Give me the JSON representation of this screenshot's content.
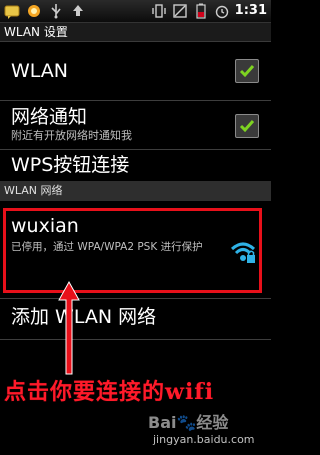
{
  "status_bar": {
    "time": "1:31",
    "left_icons": [
      "sms-icon",
      "weather-icon",
      "usb-icon",
      "upload-icon"
    ],
    "right_icons": [
      "vibrate-icon",
      "no-signal-icon",
      "battery-icon",
      "alarm-icon"
    ]
  },
  "title": "WLAN 设置",
  "settings": {
    "wlan": {
      "label": "WLAN",
      "checked": true
    },
    "network_notify": {
      "label": "网络通知",
      "subtitle": "附近有开放网络时通知我",
      "checked": true
    },
    "wps": {
      "label": "WPS按钮连接"
    }
  },
  "section_header": "WLAN 网络",
  "networks": [
    {
      "ssid": "wuxian",
      "status": "已停用，通过 WPA/WPA2 PSK 进行保护",
      "icon": "wifi-secured-icon"
    }
  ],
  "add_network": "添加 WLAN 网络",
  "annotation": {
    "text": "点击你要连接的wifi",
    "color": "#ff1a2a"
  },
  "watermark": {
    "logo": "Baidu经验",
    "url": "jingyan.baidu.com"
  },
  "colors": {
    "accent_wifi": "#2fb2e6",
    "check_green": "#7ed321",
    "highlight_border": "#e8101a"
  }
}
